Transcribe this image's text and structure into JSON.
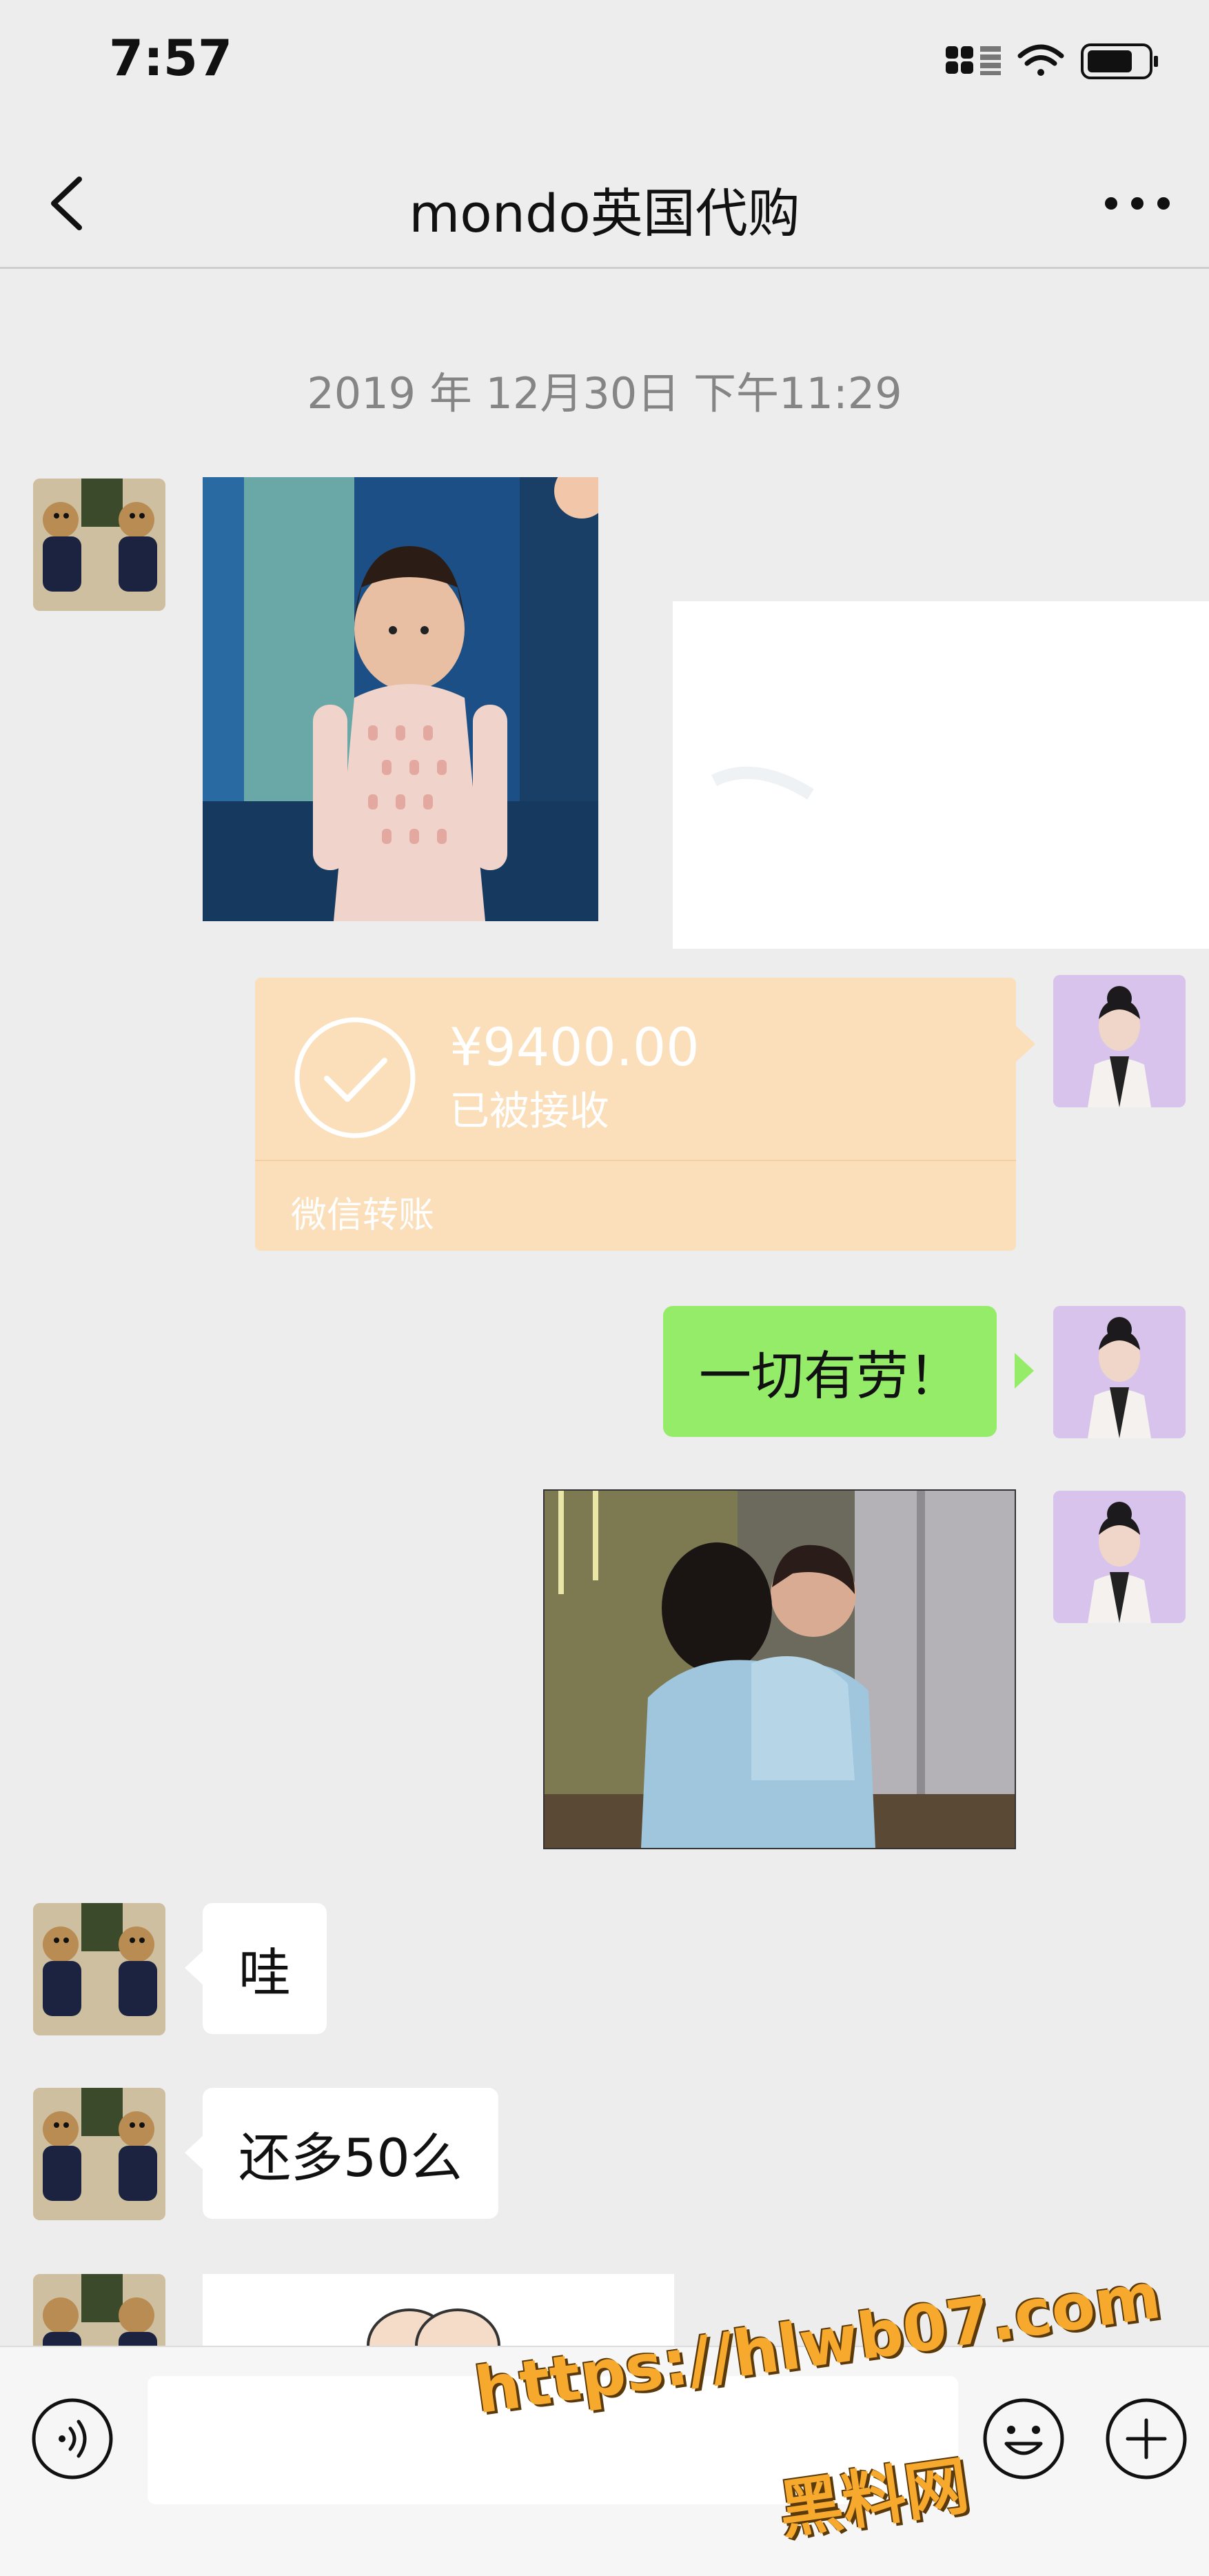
{
  "status_bar": {
    "time": "7:57",
    "icons": [
      "app-grid-icon",
      "signal-text-icon",
      "wifi-icon",
      "battery-icon"
    ]
  },
  "nav": {
    "title": "mondo英国代购",
    "back_icon": "chevron-left-icon",
    "more_icon": "more-dots-icon"
  },
  "chat": {
    "timestamp": "2019 年 12月30日 下午11:29",
    "messages": [
      {
        "sender": "contact",
        "type": "image",
        "description": "girl-in-pink-sweater-photo"
      },
      {
        "sender": "self",
        "type": "image",
        "description": "blank-white-image"
      },
      {
        "sender": "self",
        "type": "transfer",
        "amount": "¥9400.00",
        "status": "已被接收",
        "footer": "微信转账"
      },
      {
        "sender": "self",
        "type": "text",
        "text": "一切有劳！"
      },
      {
        "sender": "self",
        "type": "image",
        "description": "hugging-photo"
      },
      {
        "sender": "contact",
        "type": "text",
        "text": "哇"
      },
      {
        "sender": "contact",
        "type": "text",
        "text": "还多50么"
      },
      {
        "sender": "contact",
        "type": "image",
        "description": "sticker-partial"
      }
    ]
  },
  "input_bar": {
    "voice_icon": "voice-icon",
    "emoji_icon": "emoji-icon",
    "plus_icon": "plus-icon",
    "placeholder": ""
  },
  "watermark": {
    "url": "https://hlwb07.com",
    "label": "黑料网"
  },
  "colors": {
    "background": "#ededed",
    "self_bubble": "#95ec69",
    "contact_bubble": "#ffffff",
    "transfer_card": "#fbdfbb",
    "timestamp": "#858585"
  }
}
